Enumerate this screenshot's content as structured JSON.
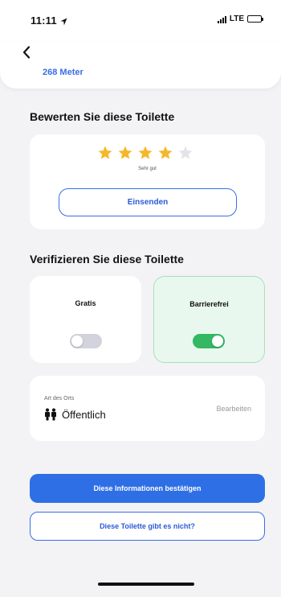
{
  "status_bar": {
    "time": "11:11",
    "network": "LTE"
  },
  "header": {
    "distance": "268 Meter"
  },
  "rating": {
    "title": "Bewerten Sie diese Toilette",
    "stars_filled": 4,
    "stars_total": 5,
    "label": "Sehr gut",
    "submit_label": "Einsenden",
    "star_color": "#f5b82a"
  },
  "verify": {
    "title": "Verifizieren Sie diese Toilette",
    "free": {
      "label": "Gratis",
      "on": false
    },
    "accessible": {
      "label": "Barrierefrei",
      "on": true
    }
  },
  "place": {
    "small_label": "Art des Orts",
    "value": "Öffentlich",
    "edit_label": "Bearbeiten"
  },
  "actions": {
    "confirm_label": "Diese Informationen bestätigen",
    "not_exist_label": "Diese Toilette gibt es nicht?"
  },
  "colors": {
    "accent": "#2f6fe6",
    "toggle_on": "#34b862",
    "toggle_off": "#d2d3dc",
    "accessible_card_bg": "#e9f8ee"
  }
}
